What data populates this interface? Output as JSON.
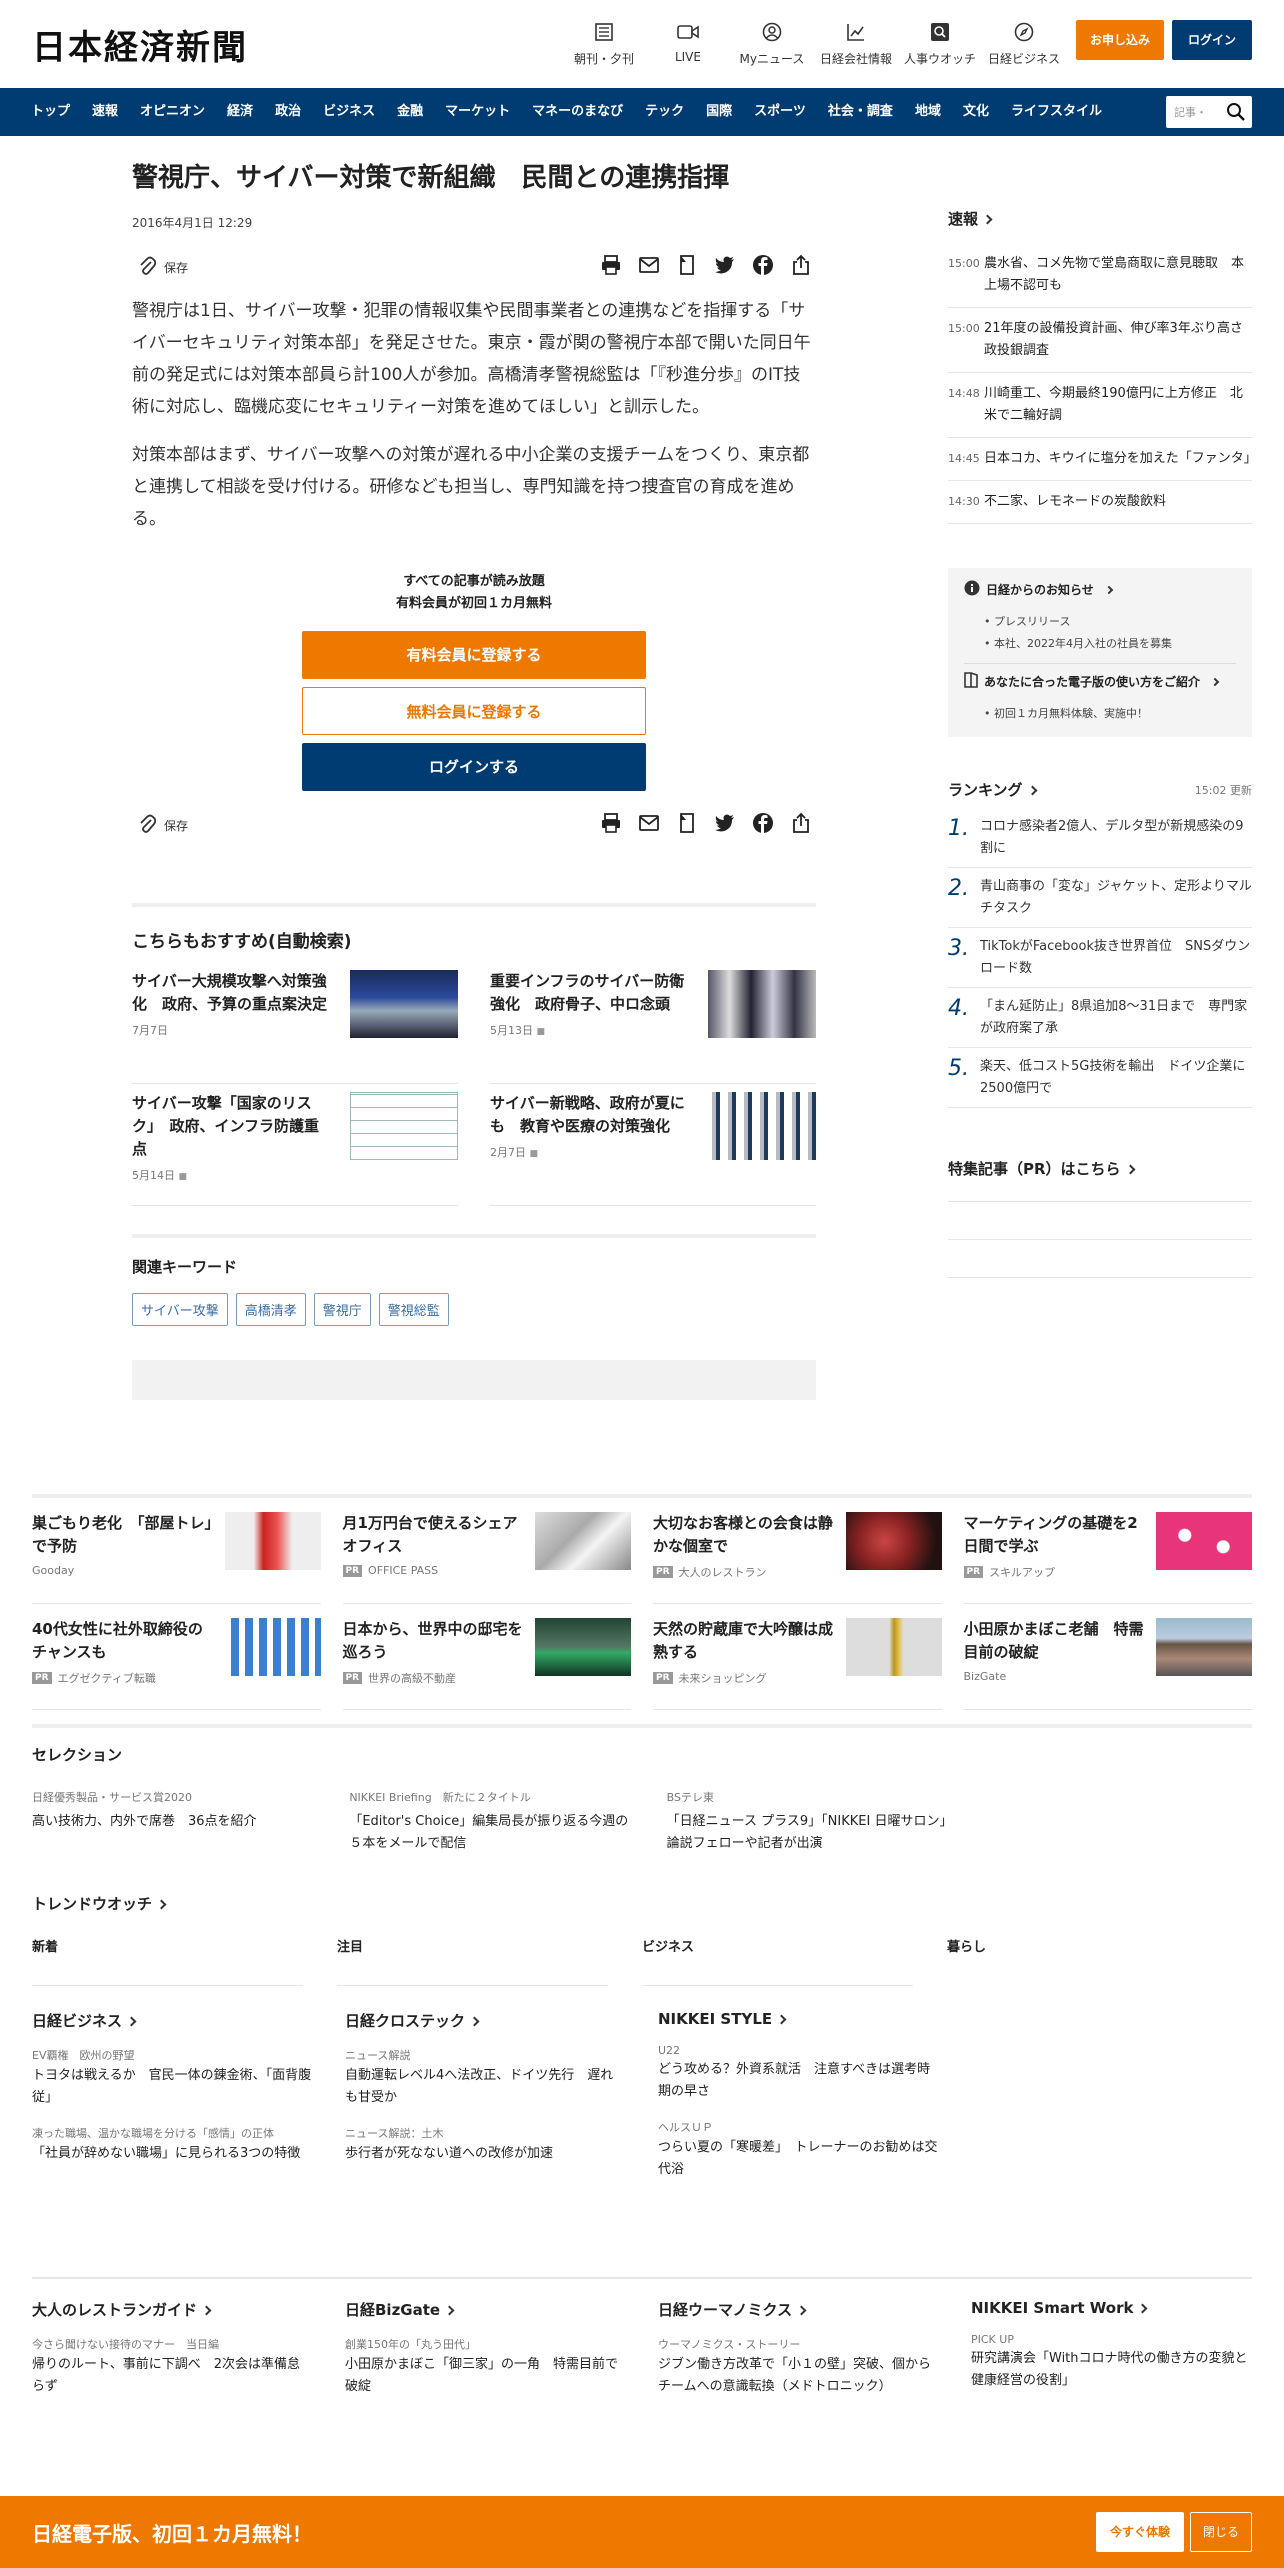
{
  "header": {
    "logo": "日本経済新聞",
    "nav": [
      "朝刊・夕刊",
      "LIVE",
      "Myニュース",
      "日経会社情報",
      "人事ウオッチ",
      "日経ビジネス"
    ],
    "subscribe": "お申し込み",
    "login": "ログイン"
  },
  "navbar": {
    "items": [
      "トップ",
      "速報",
      "オピニオン",
      "経済",
      "政治",
      "ビジネス",
      "金融",
      "マーケット",
      "マネーのまなび",
      "テック",
      "国際",
      "スポーツ",
      "社会・調査",
      "地域",
      "文化",
      "ライフスタイル"
    ],
    "search_placeholder": "記事・"
  },
  "article": {
    "title": "警視庁、サイバー対策で新組織　民間との連携指揮",
    "date": "2016年4月1日 12:29",
    "save": "保存",
    "paragraphs": [
      "警視庁は1日、サイバー攻撃・犯罪の情報収集や民間事業者との連携などを指揮する「サイバーセキュリティ対策本部」を発足させた。東京・霞が関の警視庁本部で開いた同日午前の発足式には対策本部員ら計100人が参加。高橋清孝警視総監は「『秒進分歩』のIT技術に対応し、臨機応変にセキュリティー対策を進めてほしい」と訓示した。",
      "対策本部はまず、サイバー攻撃への対策が遅れる中小企業の支援チームをつくり、東京都と連携して相談を受け付ける。研修なども担当し、専門知識を持つ捜査官の育成を進める。"
    ]
  },
  "paywall": {
    "line1": "すべての記事が読み放題",
    "line2": "有料会員が初回１カ月無料",
    "paid": "有料会員に登録する",
    "free": "無料会員に登録する",
    "login": "ログインする"
  },
  "recommend": {
    "heading": "こちらもおすすめ(自動検索)",
    "items": [
      {
        "title": "サイバー大規模攻撃へ対策強化　政府、予算の重点案決定",
        "date": "7月7日"
      },
      {
        "title": "重要インフラのサイバー防衛強化　政府骨子、中ロ念頭",
        "date": "5月13日"
      },
      {
        "title": "サイバー攻撃「国家のリスク」　政府、インフラ防護重点",
        "date": "5月14日"
      },
      {
        "title": "サイバー新戦略、政府が夏にも　教育や医療の対策強化",
        "date": "2月7日"
      }
    ]
  },
  "keywords": {
    "heading": "関連キーワード",
    "tags": [
      "サイバー攻撃",
      "高橋清孝",
      "警視庁",
      "警視総監"
    ]
  },
  "sidebar": {
    "sokuho_heading": "速報",
    "sokuho": [
      {
        "time": "15:00",
        "text": "農水省、コメ先物で堂島商取に意見聴取　本上場不認可も"
      },
      {
        "time": "15:00",
        "text": "21年度の設備投資計画、伸び率3年ぶり高さ　政投銀調査"
      },
      {
        "time": "14:48",
        "text": "川崎重工、今期最終190億円に上方修正　北米で二輪好調"
      },
      {
        "time": "14:45",
        "text": "日本コカ、キウイに塩分を加えた「ファンタ」"
      },
      {
        "time": "14:30",
        "text": "不二家、レモネードの炭酸飲料"
      }
    ],
    "notice_heading": "日経からのお知らせ",
    "notice_items": [
      "プレスリリース",
      "本社、2022年4月入社の社員を募集"
    ],
    "guide_heading": "あなたに合った電子版の使い方をご紹介",
    "guide_items": [
      "初回１カ月無料体験、実施中！"
    ],
    "ranking_heading": "ランキング",
    "ranking_updated": "15:02  更新",
    "ranking": [
      {
        "num": "1.",
        "text": "コロナ感染者2億人、デルタ型が新規感染の9割に"
      },
      {
        "num": "2.",
        "text": "青山商事の「変な」ジャケット、定形よりマルチタスク"
      },
      {
        "num": "3.",
        "text": "TikTokがFacebook抜き世界首位　SNSダウンロード数"
      },
      {
        "num": "4.",
        "text": "「まん延防止」8県追加8～31日まで　専門家が政府案了承"
      },
      {
        "num": "5.",
        "text": "楽天、低コスト5G技術を輸出　ドイツ企業に2500億円で"
      }
    ],
    "pr_heading": "特集記事（PR）はこちら"
  },
  "ads": [
    {
      "title": "巣ごもり老化　「部屋トレ」で予防",
      "source": "Gooday",
      "pr": false
    },
    {
      "title": "月1万円台で使えるシェアオフィス",
      "source": "OFFICE PASS",
      "pr": true
    },
    {
      "title": "大切なお客様との会食は静かな個室で",
      "source": "大人のレストラン",
      "pr": true
    },
    {
      "title": "マーケティングの基礎を2日間で学ぶ",
      "source": "スキルアップ",
      "pr": true
    },
    {
      "title": "40代女性に社外取締役のチャンスも",
      "source": "エグゼクティブ転職",
      "pr": true
    },
    {
      "title": "日本から、世界中の邸宅を巡ろう",
      "source": "世界の高級不動産",
      "pr": true
    },
    {
      "title": "天然の貯蔵庫で大吟醸は成熟する",
      "source": "未来ショッピング",
      "pr": true
    },
    {
      "title": "小田原かまぼこ老舗　特需目前の破綻",
      "source": "BizGate",
      "pr": false
    }
  ],
  "pr_label": "PR",
  "selection": {
    "heading": "セレクション",
    "items": [
      {
        "sub": "日経優秀製品・サービス賞2020",
        "title": "高い技術力、内外で席巻　36点を紹介"
      },
      {
        "sub": "NIKKEI Briefing　新たに２タイトル",
        "title": "「Editor's Choice」編集局長が振り返る今週の５本をメールで配信"
      },
      {
        "sub": "BSテレ東",
        "title": "「日経ニュース プラス9」「NIKKEI 日曜サロン」論説フェローや記者が出演"
      }
    ]
  },
  "trend": {
    "heading": "トレンドウオッチ",
    "cols": [
      "新着",
      "注目",
      "ビジネス",
      "暮らし"
    ]
  },
  "media": [
    {
      "heading": "日経ビジネス",
      "blocks": [
        {
          "sub": "EV覇権　欧州の野望",
          "title": "トヨタは戦えるか　官民一体の錬金術、「面背腹従」"
        },
        {
          "sub": "凍った職場、温かな職場を分ける「感情」の正体",
          "title": "「社員が辞めない職場」に見られる3つの特徴"
        }
      ]
    },
    {
      "heading": "日経クロステック",
      "blocks": [
        {
          "sub": "ニュース解説",
          "title": "自動運転レベル4へ法改正、ドイツ先行　遅れも甘受か"
        },
        {
          "sub": "ニュース解説：土木",
          "title": "歩行者が死なない道への改修が加速"
        }
      ]
    },
    {
      "heading": "NIKKEI STYLE",
      "blocks": [
        {
          "sub": "U22",
          "title": "どう攻める？外資系就活　注意すべきは選考時期の早さ"
        },
        {
          "sub": "ヘルスＵＰ",
          "title": "つらい夏の「寒暖差」　トレーナーのお勧めは交代浴"
        }
      ]
    },
    {
      "heading": "",
      "blocks": []
    }
  ],
  "media2": [
    {
      "heading": "大人のレストランガイド",
      "sub": "今さら聞けない接待のマナー　当日編",
      "title": "帰りのルート、事前に下調べ　2次会は準備怠らず"
    },
    {
      "heading": "日経BizGate",
      "sub": "創業150年の「丸う田代」",
      "title": "小田原かまぼこ「御三家」の一角　特需目前で破綻"
    },
    {
      "heading": "日経ウーマノミクス",
      "sub": "ウーマノミクス・ストーリー",
      "title": "ジブン働き方改革で「小１の壁」突破、個からチームへの意識転換（メドトロニック）"
    },
    {
      "heading": "NIKKEI Smart Work",
      "sub": "PICK UP",
      "title": "研究講演会「Withコロナ時代の働き方の変貌と健康経営の役割」"
    }
  ],
  "footer": {
    "text": "日経電子版、初回１カ月無料！",
    "try": "今すぐ体験",
    "close": "閉じる"
  },
  "colors": {
    "navy": "#003b71",
    "orange": "#ee7800"
  }
}
